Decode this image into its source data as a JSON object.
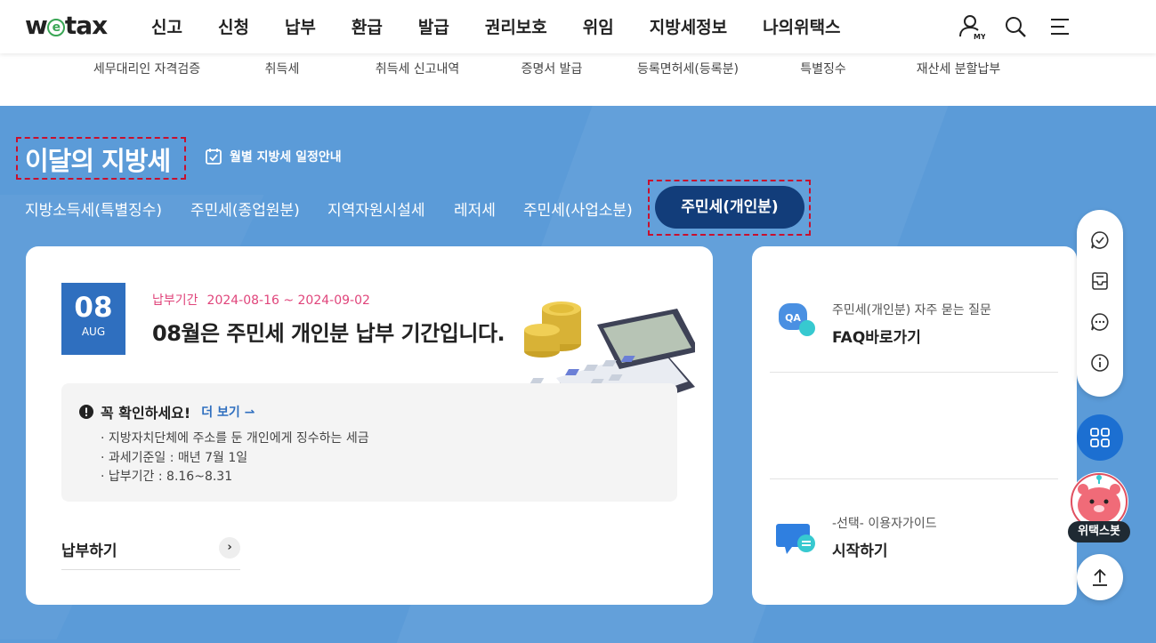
{
  "header": {
    "logo": "wetax",
    "nav": [
      "신고",
      "신청",
      "납부",
      "환급",
      "발급",
      "권리보호",
      "위임",
      "지방세정보",
      "나의위택스"
    ],
    "icons": [
      "my-page-icon",
      "search-icon",
      "menu-icon"
    ],
    "my_badge": "MY"
  },
  "submenu": [
    "세무대리인 자격검증",
    "취득세",
    "취득세 신고내역",
    "증명서 발급",
    "등록면허세(등록분)",
    "특별징수",
    "재산세 분할납부"
  ],
  "section": {
    "title": "이달의 지방세",
    "schedule_link": "월별 지방세 일정안내",
    "tabs": [
      "지방소득세(특별징수)",
      "주민세(종업원분)",
      "지역자원시설세",
      "레저세",
      "주민세(사업소분)"
    ],
    "active_tab": "주민세(개인분)"
  },
  "main_card": {
    "date_num": "08",
    "date_month": "AUG",
    "period_label": "납부기간",
    "period_value": "2024-08-16 ~ 2024-09-02",
    "headline": "08월은 주민세 개인분 납부 기간입니다.",
    "notice": {
      "title": "꼭 확인하세요!",
      "more": "더 보기",
      "items": [
        "지방자치단체에 주소를 둔 개인에게 징수하는 세금",
        "과세기준일 : 매년 7월 1일",
        "납부기간 : 8.16~8.31"
      ]
    },
    "pay_link": "납부하기"
  },
  "side_card": {
    "faq_sub": "주민세(개인분) 자주 묻는 질문",
    "faq_main": "FAQ바로가기",
    "faq_badge": "QA",
    "guide_sub": "-선택- 이용자가이드",
    "guide_main": "시작하기"
  },
  "quick_menu": {
    "icons": [
      "chat-check-icon",
      "inbox-icon",
      "chat-bubble-icon",
      "info-icon",
      "apps-grid-icon",
      "chatbot-icon",
      "scroll-top-icon"
    ],
    "bot_label": "위택스봇"
  },
  "colors": {
    "hero_bg": "#5b9bd8",
    "active_tab": "#123d7a",
    "date_box": "#2f6fbf",
    "period": "#e0457b",
    "annotation": "#c8102e"
  }
}
